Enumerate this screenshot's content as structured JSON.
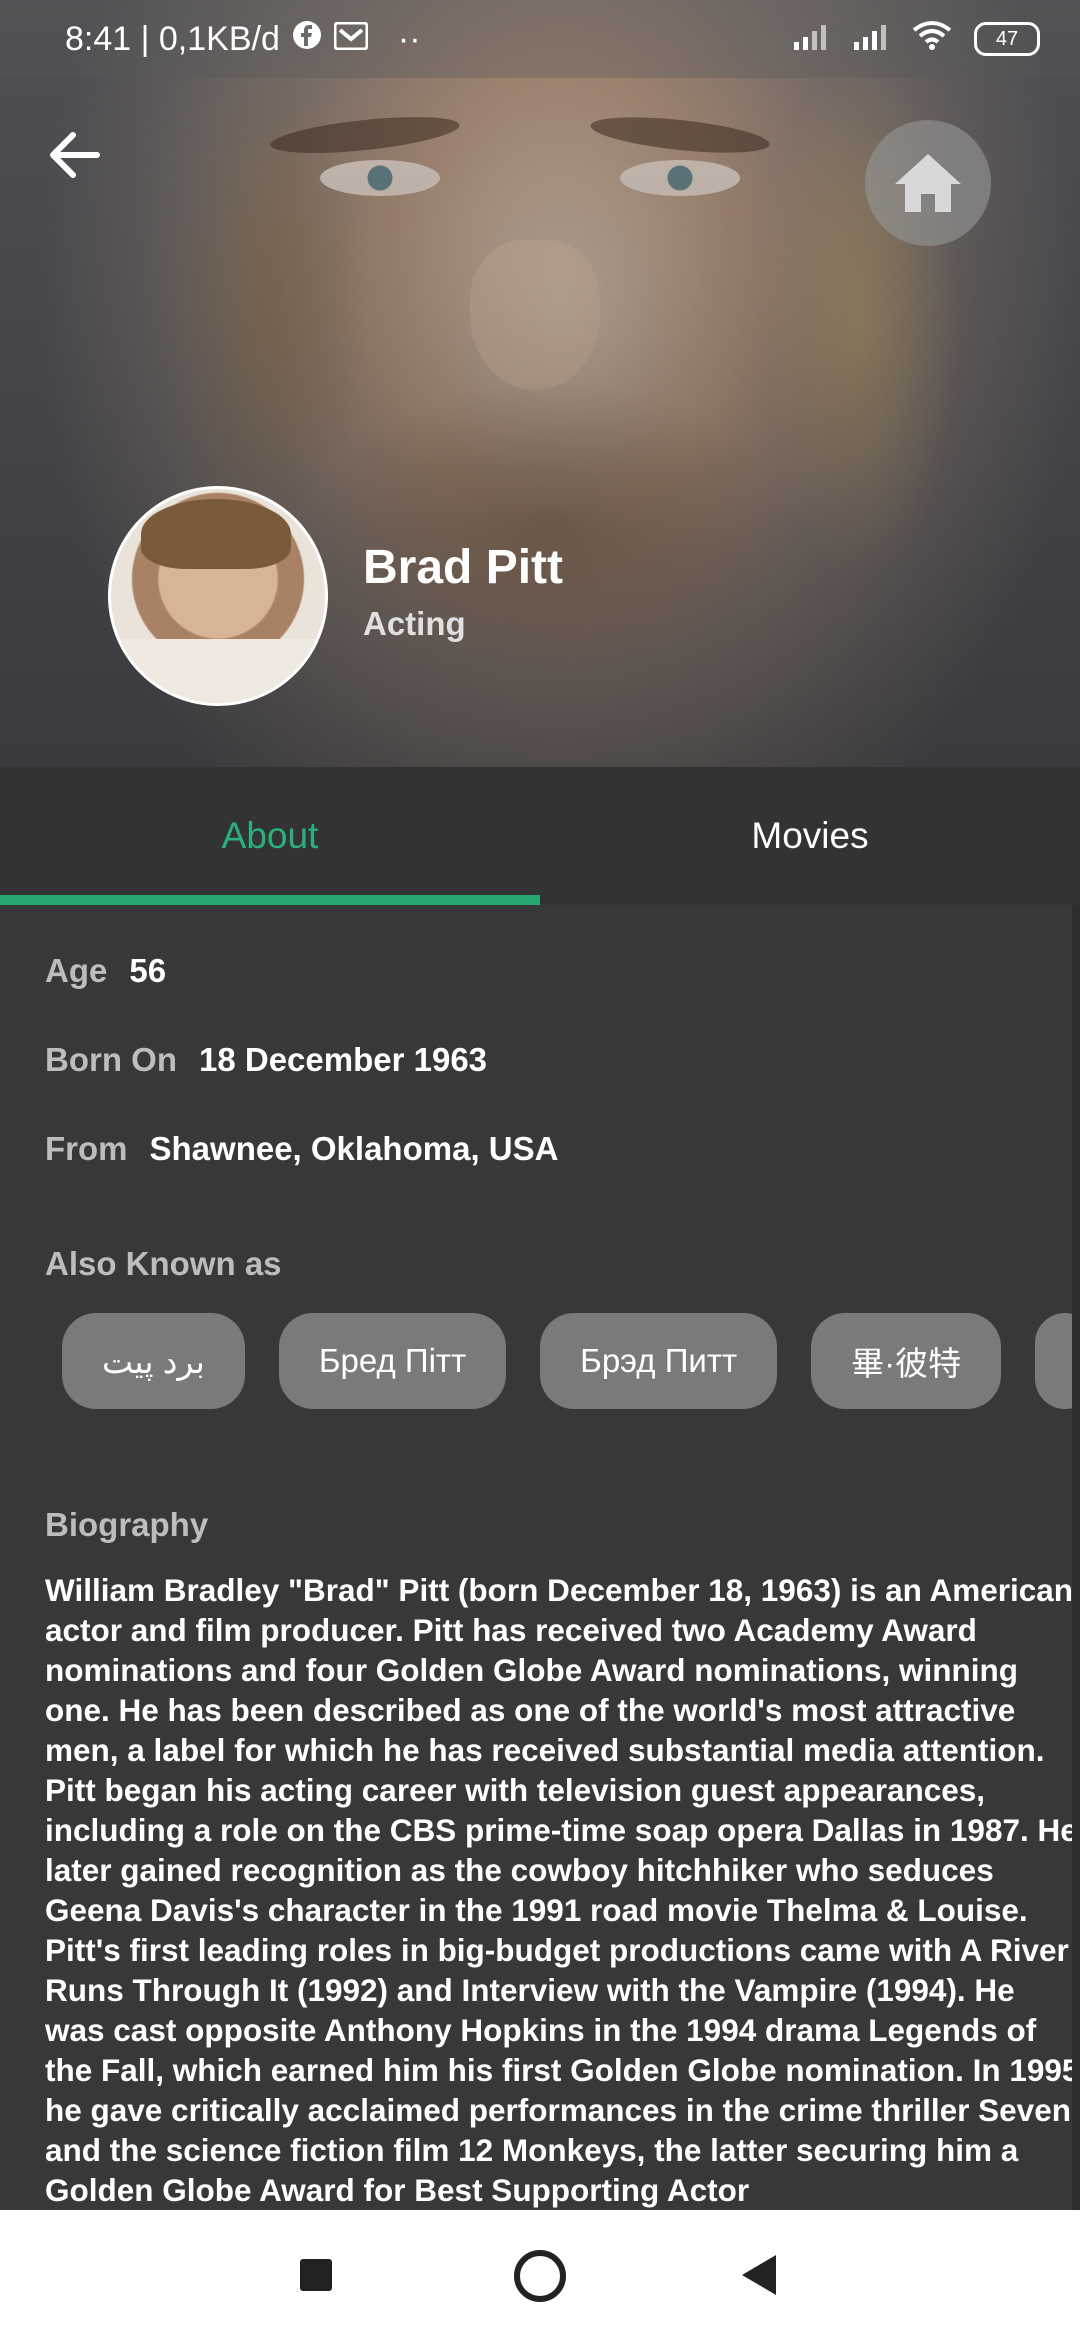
{
  "status_bar": {
    "time_info": "8:41 | 0,1KB/d",
    "dots": "··",
    "battery": "47",
    "icons": [
      "facebook-icon",
      "mail-icon",
      "signal-icon",
      "signal-icon",
      "wifi-icon",
      "battery-icon"
    ]
  },
  "header": {
    "back_icon": "arrow-left-icon",
    "home_icon": "home-icon",
    "name": "Brad Pitt",
    "department": "Acting"
  },
  "tabs": [
    {
      "label": "About",
      "active": true
    },
    {
      "label": "Movies",
      "active": false
    }
  ],
  "colors": {
    "accent": "#26a86f",
    "background": "#38383a",
    "chip": "#7a7a7c"
  },
  "about": {
    "age_label": "Age",
    "age_value": "56",
    "born_label": "Born On",
    "born_value": "18 December 1963",
    "from_label": "From",
    "from_value": "Shawnee, Oklahoma, USA",
    "aka_title": "Also Known as",
    "aka": [
      "برد پیت",
      "Бред Пітт",
      "Брэд Питт",
      "畢·彼特"
    ],
    "bio_title": "Biography",
    "biography": "William Bradley \"Brad\" Pitt (born December 18, 1963) is an American actor and film producer. Pitt has received two Academy Award nominations and four Golden Globe Award nominations, winning one. He has been described as one of the world's most attractive men, a label for which he has received substantial media attention. Pitt began his acting career with television guest appearances, including a role on the CBS prime-time soap opera Dallas in 1987. He later gained recognition as the cowboy hitchhiker who seduces Geena Davis's character in the 1991 road movie Thelma & Louise. Pitt's first leading roles in big-budget productions came with A River Runs Through It (1992) and Interview with the Vampire (1994). He was cast opposite Anthony Hopkins in the 1994 drama Legends of the Fall, which earned him his first Golden Globe nomination. In 1995 he gave critically acclaimed performances in the crime thriller Seven and the science fiction film 12 Monkeys, the latter securing him a Golden Globe Award for Best Supporting Actor"
  },
  "nav": {
    "icons": [
      "recents-square-icon",
      "home-circle-icon",
      "back-triangle-icon"
    ]
  }
}
